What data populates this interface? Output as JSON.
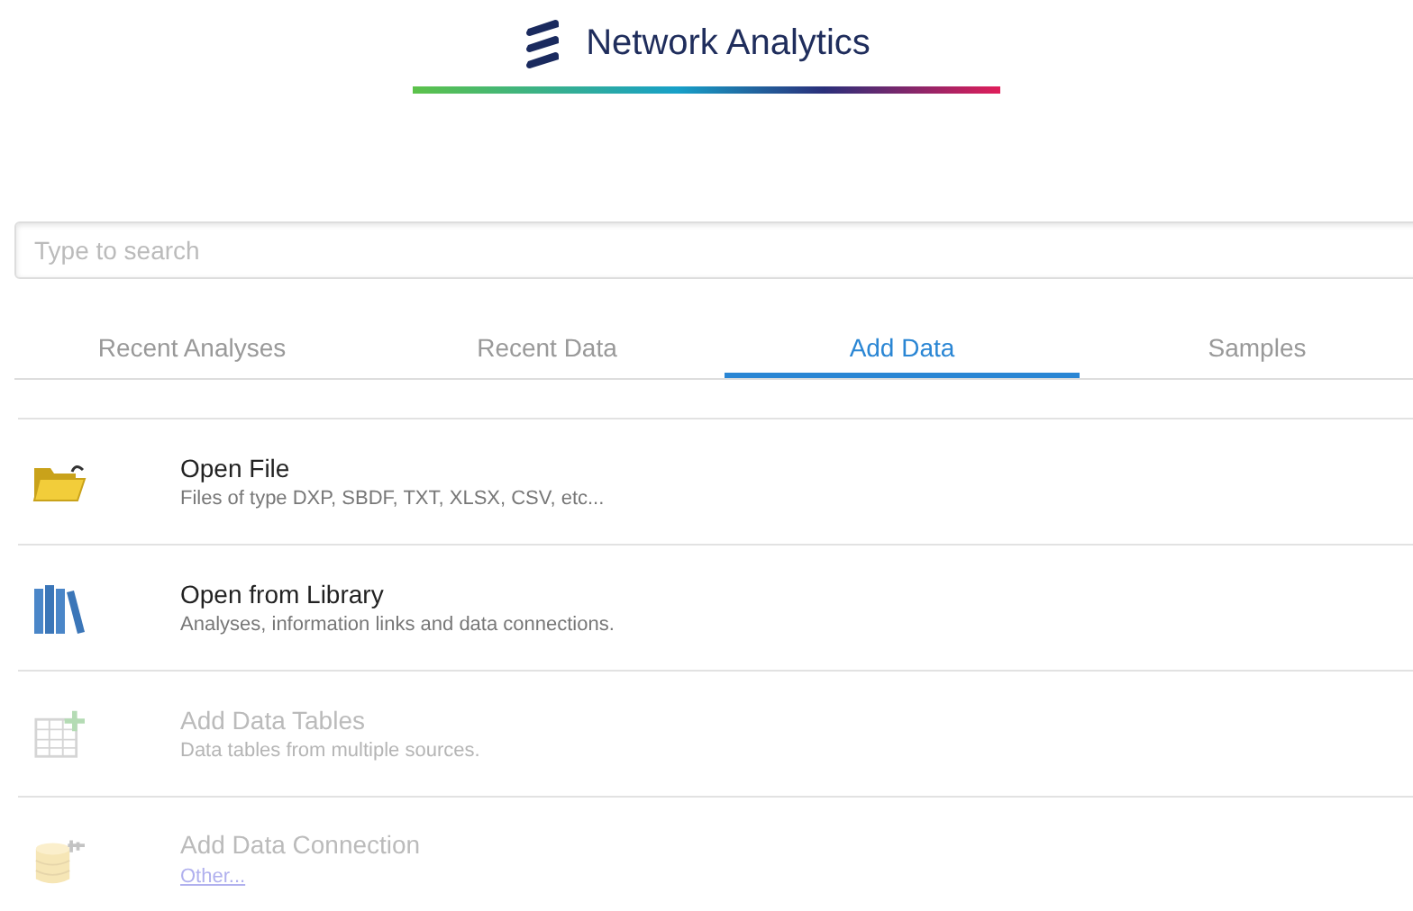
{
  "header": {
    "title": "Network Analytics"
  },
  "search": {
    "placeholder": "Type to search"
  },
  "tabs": [
    {
      "label": "Recent Analyses",
      "selected": false
    },
    {
      "label": "Recent Data",
      "selected": false
    },
    {
      "label": "Add Data",
      "selected": true
    },
    {
      "label": "Samples",
      "selected": false
    }
  ],
  "items": [
    {
      "kind": "folder",
      "title": "Open File",
      "subtitle": "Files of type DXP, SBDF, TXT, XLSX, CSV, etc...",
      "disabled": false
    },
    {
      "kind": "library",
      "title": "Open from Library",
      "subtitle": "Analyses, information links and data connections.",
      "disabled": false
    },
    {
      "kind": "table",
      "title": "Add Data Tables",
      "subtitle": "Data tables from multiple sources.",
      "disabled": true
    },
    {
      "kind": "database",
      "title": "Add Data Connection",
      "link": "Other...",
      "disabled": true
    }
  ]
}
